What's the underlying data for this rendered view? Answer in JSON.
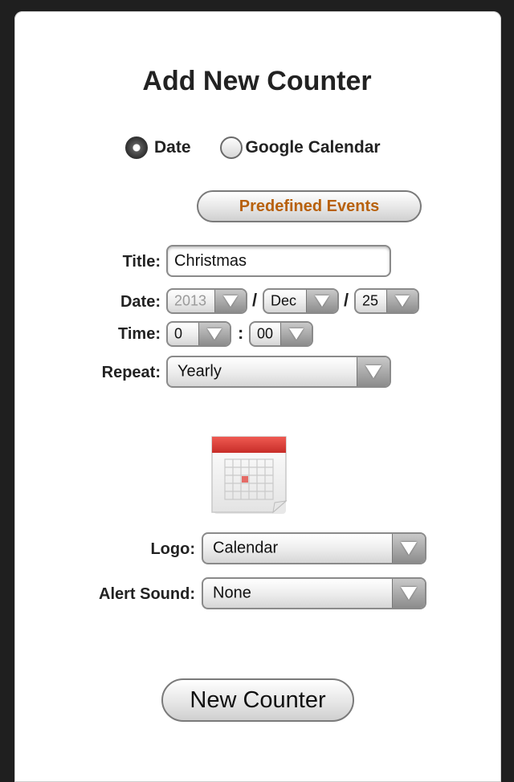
{
  "form": {
    "title": "Add New Counter",
    "source_options": [
      {
        "label": "Date",
        "selected": true
      },
      {
        "label": "Google Calendar",
        "selected": false
      }
    ],
    "predefined_events_label": "Predefined Events",
    "title_label": "Title:",
    "title_value": "Christmas",
    "date_label": "Date:",
    "date_year": "2013",
    "date_month": "Dec",
    "date_day": "25",
    "date_separator": "/",
    "time_label": "Time:",
    "time_hour": "0",
    "time_minute": "00",
    "time_separator": ":",
    "repeat_label": "Repeat:",
    "repeat_value": "Yearly",
    "logo_icon": "calendar-icon",
    "logo_label": "Logo:",
    "logo_value": "Calendar",
    "alert_label": "Alert Sound:",
    "alert_value": "None",
    "submit_label": "New Counter"
  },
  "colors": {
    "accent_text": "#b8610c",
    "calendar_red": "#d63b36"
  }
}
